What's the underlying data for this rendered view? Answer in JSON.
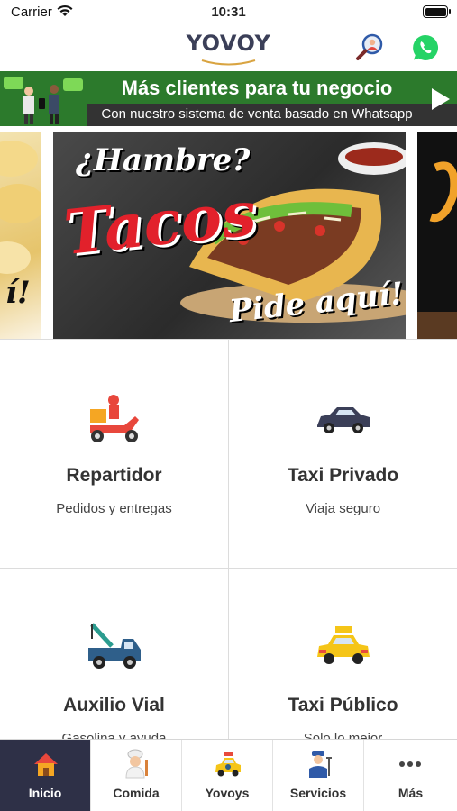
{
  "status_bar": {
    "carrier": "Carrier",
    "time": "10:31"
  },
  "header": {
    "logo_text": "YOVOY"
  },
  "promo": {
    "title": "Más clientes para tu negocio",
    "subtitle": "Con nuestro sistema de venta basado en Whatsapp"
  },
  "carousel": {
    "headline": "¿Hambre?",
    "title": "Tacos",
    "cta": "Pide aquí!"
  },
  "services": [
    {
      "title": "Repartidor",
      "subtitle": "Pedidos y entregas",
      "icon": "delivery-scooter-icon"
    },
    {
      "title": "Taxi Privado",
      "subtitle": "Viaja seguro",
      "icon": "private-car-icon"
    },
    {
      "title": "Auxilio Vial",
      "subtitle": "Gasolina y ayuda",
      "icon": "tow-truck-icon"
    },
    {
      "title": "Taxi Público",
      "subtitle": "Solo lo mejor",
      "icon": "taxi-icon"
    }
  ],
  "tabs": [
    {
      "label": "Inicio",
      "icon": "home-icon",
      "active": true
    },
    {
      "label": "Comida",
      "icon": "chef-icon",
      "active": false
    },
    {
      "label": "Yovoys",
      "icon": "yovoy-taxi-icon",
      "active": false
    },
    {
      "label": "Servicios",
      "icon": "mechanic-icon",
      "active": false
    },
    {
      "label": "Más",
      "icon": "more-dots-icon",
      "active": false
    }
  ],
  "colors": {
    "promo_green": "#2c7a2c",
    "tab_active": "#2e3047",
    "brand_red": "#e2212b",
    "logo": "#3b3f58"
  }
}
